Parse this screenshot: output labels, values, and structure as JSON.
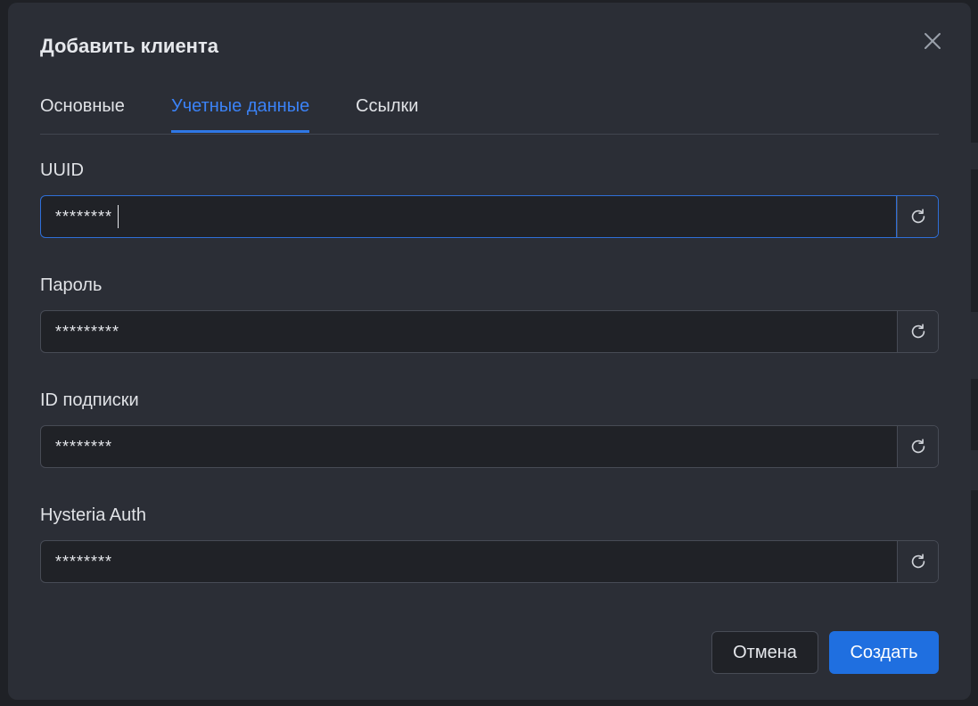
{
  "dialog": {
    "title": "Добавить клиента",
    "close_icon": "close-icon"
  },
  "tabs": [
    {
      "label": "Основные",
      "active": false
    },
    {
      "label": "Учетные данные",
      "active": true
    },
    {
      "label": "Ссылки",
      "active": false
    }
  ],
  "fields": [
    {
      "label": "UUID",
      "value": "********",
      "focused": true,
      "action_icon": "refresh-icon"
    },
    {
      "label": "Пароль",
      "value": "*********",
      "focused": false,
      "action_icon": "refresh-icon"
    },
    {
      "label": "ID подписки",
      "value": "********",
      "focused": false,
      "action_icon": "refresh-icon"
    },
    {
      "label": "Hysteria Auth",
      "value": "********",
      "focused": false,
      "action_icon": "refresh-icon"
    }
  ],
  "footer": {
    "cancel_label": "Отмена",
    "create_label": "Создать"
  },
  "colors": {
    "accent": "#1f6fe0",
    "active_tab": "#3b82f6",
    "modal_bg": "#2b2e36",
    "input_bg": "#202227"
  }
}
